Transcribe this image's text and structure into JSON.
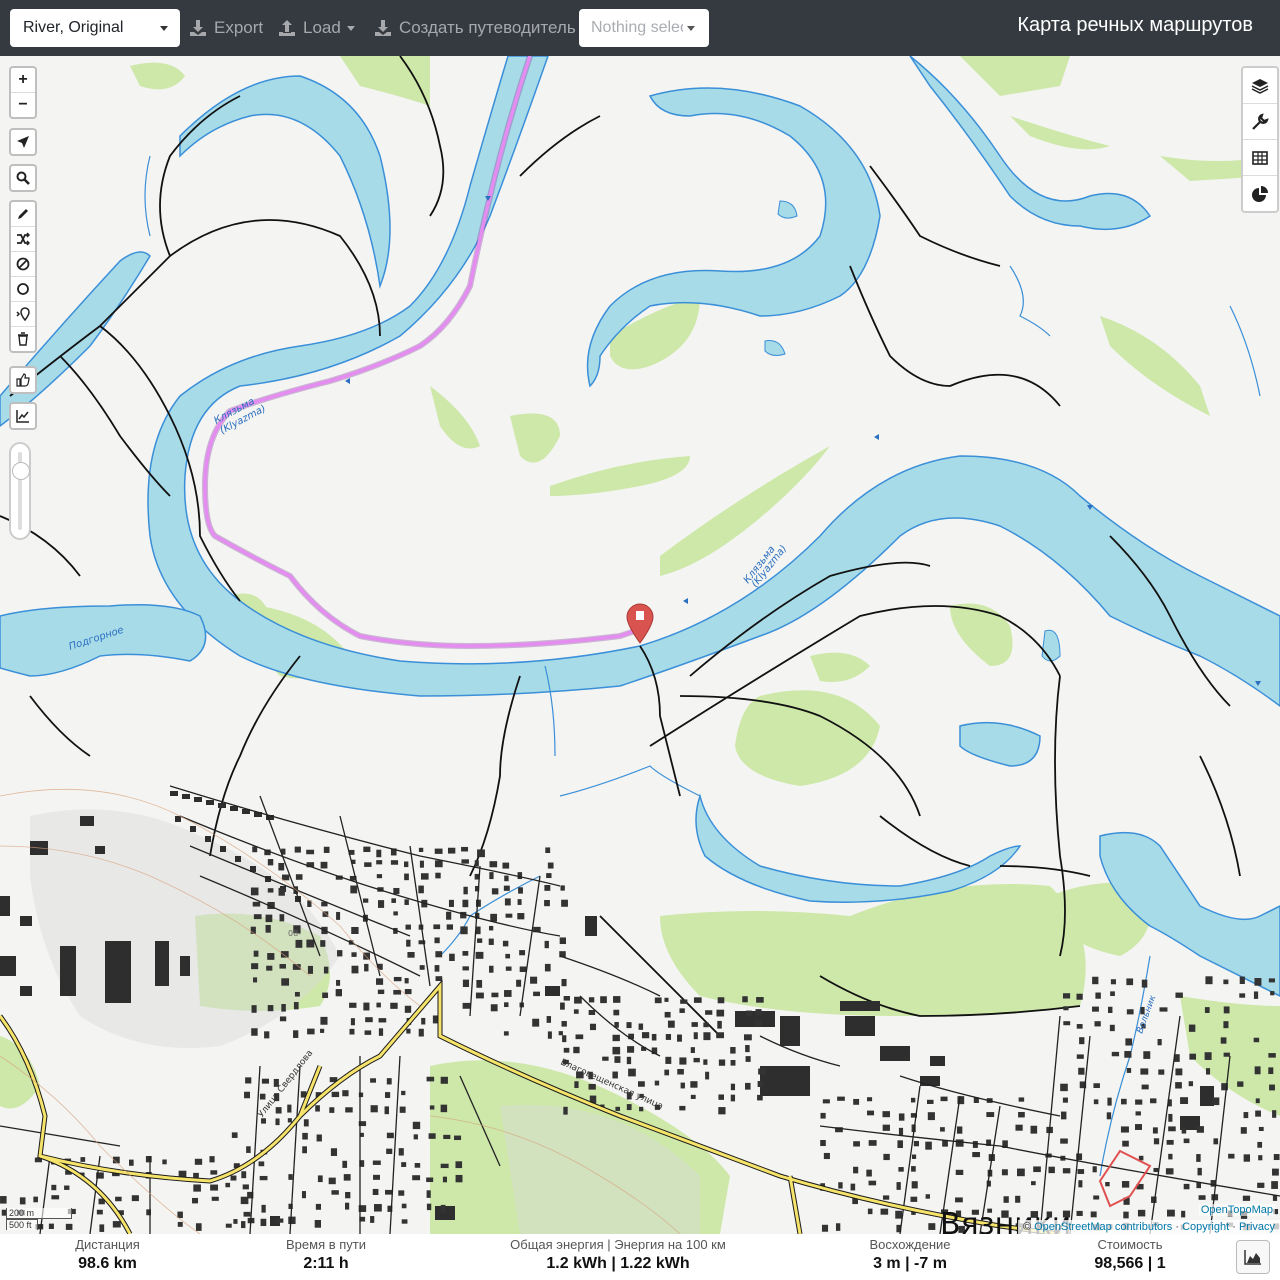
{
  "header": {
    "profile": "River, Original",
    "export_label": "Export",
    "load_label": "Load",
    "guide_label": "Создать путеводитель",
    "selector_placeholder": "Nothing selected",
    "title": "Карта речных маршрутов"
  },
  "map": {
    "river_name_1": "Клязьма",
    "river_name_1_lat": "(Klyazma)",
    "river_name_2": "Клязьма",
    "river_name_2_lat": "(Klyazma)",
    "lake_name": "Подгорное",
    "street_1": "Благовещенская улица",
    "street_2": "Улица Свердлова",
    "stream_name": "Вольник",
    "town_name": "Вязники",
    "road_ref": "08-"
  },
  "left_toolbar": {
    "zoom_in": "+",
    "zoom_out": "−"
  },
  "scale": {
    "metric": "200 m",
    "imperial": "500 ft"
  },
  "attribution": {
    "provider": "OpenTopoMap",
    "prefix": "©",
    "osm": "OpenStreetMap contributors",
    "copyright": "Copyright",
    "privacy": "Privacy"
  },
  "stats": {
    "distance_label": "Дистанция",
    "distance_value": "98.6 km",
    "time_label": "Время в пути",
    "time_value": "2:11 h",
    "energy_label": "Общая энергия | Энергия на 100 км",
    "energy_value": "1.2 kWh | 1.22 kWh",
    "ascent_label": "Восхождение",
    "ascent_value": "3 m | -7 m",
    "cost_label": "Стоимость",
    "cost_value": "98,566 | 1"
  },
  "colors": {
    "topbar": "#343a40",
    "water": "#a8dbe8",
    "water_edge": "#3a8fd8",
    "route": "#e48cf0",
    "forest": "#c8e6a0",
    "marker": "#d9534f"
  }
}
